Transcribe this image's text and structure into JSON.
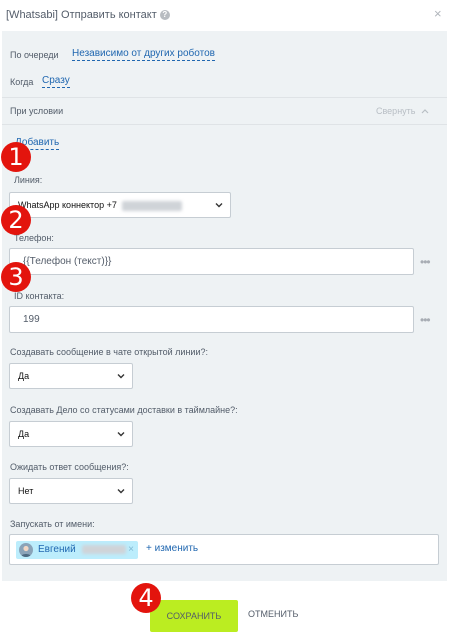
{
  "dialog": {
    "title": "[Whatsabi] Отправить контакт",
    "help_icon": "?",
    "close_icon": "×"
  },
  "queue": {
    "label": "По очереди",
    "value": "Независимо от других роботов"
  },
  "when": {
    "label": "Когда",
    "value": "Сразу"
  },
  "condition": {
    "label": "При условии",
    "collapse": "Свернуть",
    "add": "Добавить"
  },
  "line": {
    "label": "Линия:",
    "value": "WhatsApp коннектор +7"
  },
  "phone": {
    "label": "Телефон:",
    "value": "{{Телефон (текст)}}"
  },
  "contact": {
    "label": "ID контакта:",
    "value": "199"
  },
  "create_message": {
    "label": "Создавать сообщение в чате открытой линии?:",
    "value": "Да"
  },
  "create_task": {
    "label": "Создавать Дело со статусами доставки в таймлайне?:",
    "value": "Да"
  },
  "wait_reply": {
    "label": "Ожидать ответ сообщения?:",
    "value": "Нет"
  },
  "run_as": {
    "label": "Запускать от имени:",
    "user": "Евгений",
    "change": "+ изменить"
  },
  "buttons": {
    "save": "СОХРАНИТЬ",
    "cancel": "ОТМЕНИТЬ"
  },
  "annotations": [
    "1",
    "2",
    "3",
    "4"
  ],
  "colors": {
    "link": "#2067b0",
    "save": "#bbed21",
    "badge": "#e3140d",
    "panel": "#eef2f4"
  }
}
